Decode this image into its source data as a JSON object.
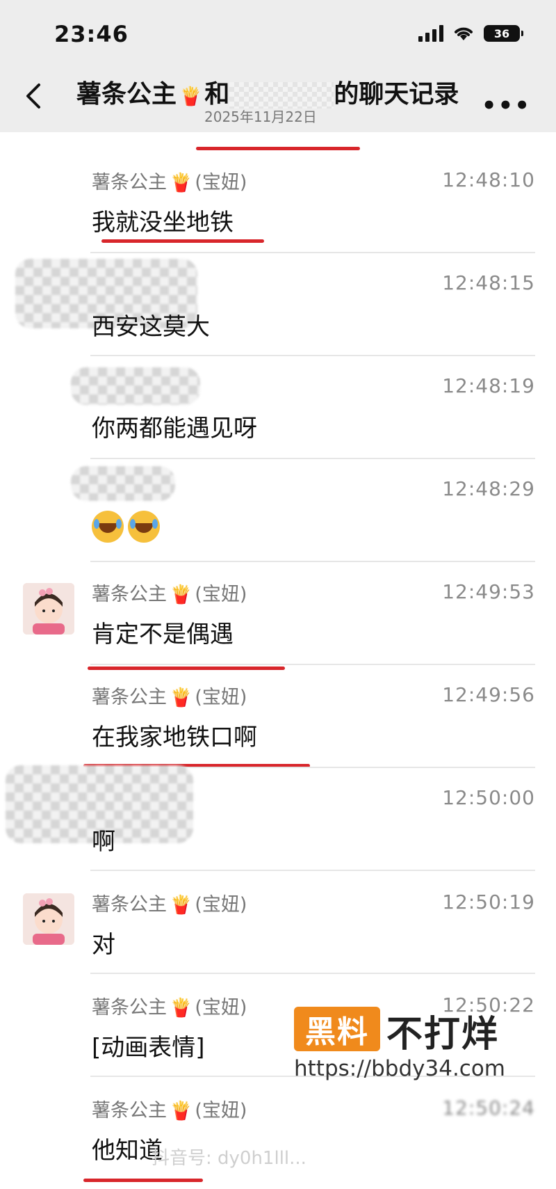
{
  "status_bar": {
    "time": "23:46",
    "battery": "36"
  },
  "header": {
    "title_left": "薯条公主",
    "title_icon": "fries-emoji",
    "title_mid": "和",
    "title_right": "的聊天记录",
    "date": "2025年11月22日"
  },
  "icons": {
    "fries": "🍟"
  },
  "messages": [
    {
      "sender": "薯条公主",
      "sender_note": "(宝妞)",
      "time": "12:48:10",
      "text": "我就没坐地铁"
    },
    {
      "sender": "",
      "time": "12:48:15",
      "text": "西安这莫大"
    },
    {
      "sender": "",
      "time": "12:48:19",
      "text": "你两都能遇见呀"
    },
    {
      "sender": "",
      "time": "12:48:29",
      "text": "",
      "emoji": "laughing-crying-emoji"
    },
    {
      "sender": "薯条公主",
      "sender_note": "(宝妞)",
      "time": "12:49:53",
      "text": "肯定不是偶遇"
    },
    {
      "sender": "薯条公主",
      "sender_note": "(宝妞)",
      "time": "12:49:56",
      "text": "在我家地铁口啊"
    },
    {
      "sender": "",
      "time": "12:50:00",
      "text": "啊"
    },
    {
      "sender": "薯条公主",
      "sender_note": "(宝妞)",
      "time": "12:50:19",
      "text": "对"
    },
    {
      "sender": "薯条公主",
      "sender_note": "(宝妞)",
      "time": "12:50:22",
      "text": "[动画表情]"
    },
    {
      "sender": "薯条公主",
      "sender_note": "(宝妞)",
      "time": "12:50:24",
      "text": "他知道"
    }
  ],
  "watermark": {
    "badge": "黑料",
    "text": "不打烊",
    "url": "https://bbdy34.com",
    "douyin": "抖音号: dy0h1lll..."
  },
  "colors": {
    "underline": "#d8262b",
    "watermark_orange": "#f08a1c"
  }
}
